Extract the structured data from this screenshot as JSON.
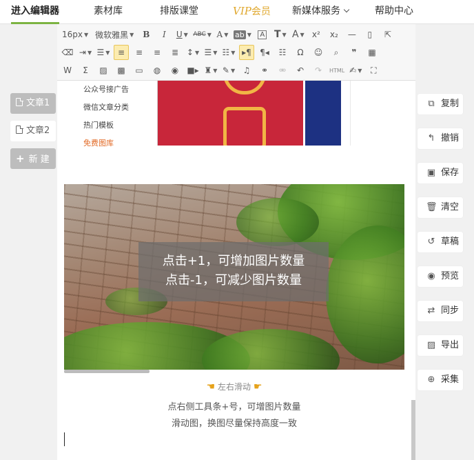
{
  "nav": {
    "items": [
      {
        "label": "进入编辑器"
      },
      {
        "label": "素材库"
      },
      {
        "label": "排版课堂"
      },
      {
        "vip": "VIP",
        "label": "会员"
      },
      {
        "label": "新媒体服务"
      },
      {
        "label": "帮助中心"
      }
    ]
  },
  "articles": {
    "tab1": "文章1",
    "tab2": "文章2",
    "new": "新 建"
  },
  "toolbar": {
    "font_size": "16px",
    "font_family": "微软雅黑",
    "bold": "B",
    "italic": "I",
    "underline": "U",
    "abc": "ABC",
    "font_color": "A",
    "bg_color": "ab",
    "border_a": "A",
    "text_t": "T",
    "text_a2": "A",
    "superscript": "x²",
    "subscript": "x₂",
    "omega": "Ω",
    "quote": "❞",
    "html": "HTML",
    "sigma": "Σ"
  },
  "preview_menu": {
    "items": [
      "公众号接广告",
      "微信文章分类",
      "热门模板",
      "免费图库"
    ]
  },
  "overlay": {
    "line1": "点击+1，可增加图片数量",
    "line2": "点击-1，可减少图片数量"
  },
  "swipe_hint": "左右滑动",
  "captions": {
    "line1": "点右侧工具条+号，可增图片数量",
    "line2": "滑动图，换图尽量保持高度一致"
  },
  "actions": [
    {
      "label": "复制",
      "icon": "copy-icon"
    },
    {
      "label": "撤销",
      "icon": "undo-icon"
    },
    {
      "label": "保存",
      "icon": "save-icon"
    },
    {
      "label": "清空",
      "icon": "trash-icon"
    },
    {
      "label": "草稿",
      "icon": "history-icon"
    },
    {
      "label": "预览",
      "icon": "eye-icon"
    },
    {
      "label": "同步",
      "icon": "sync-icon"
    },
    {
      "label": "导出",
      "icon": "export-icon"
    },
    {
      "label": "采集",
      "icon": "search-plus-icon"
    }
  ],
  "colors": {
    "accent_green": "#7cb342",
    "vip_gold": "#e0a82e",
    "highlight_orange": "#e26a26"
  }
}
